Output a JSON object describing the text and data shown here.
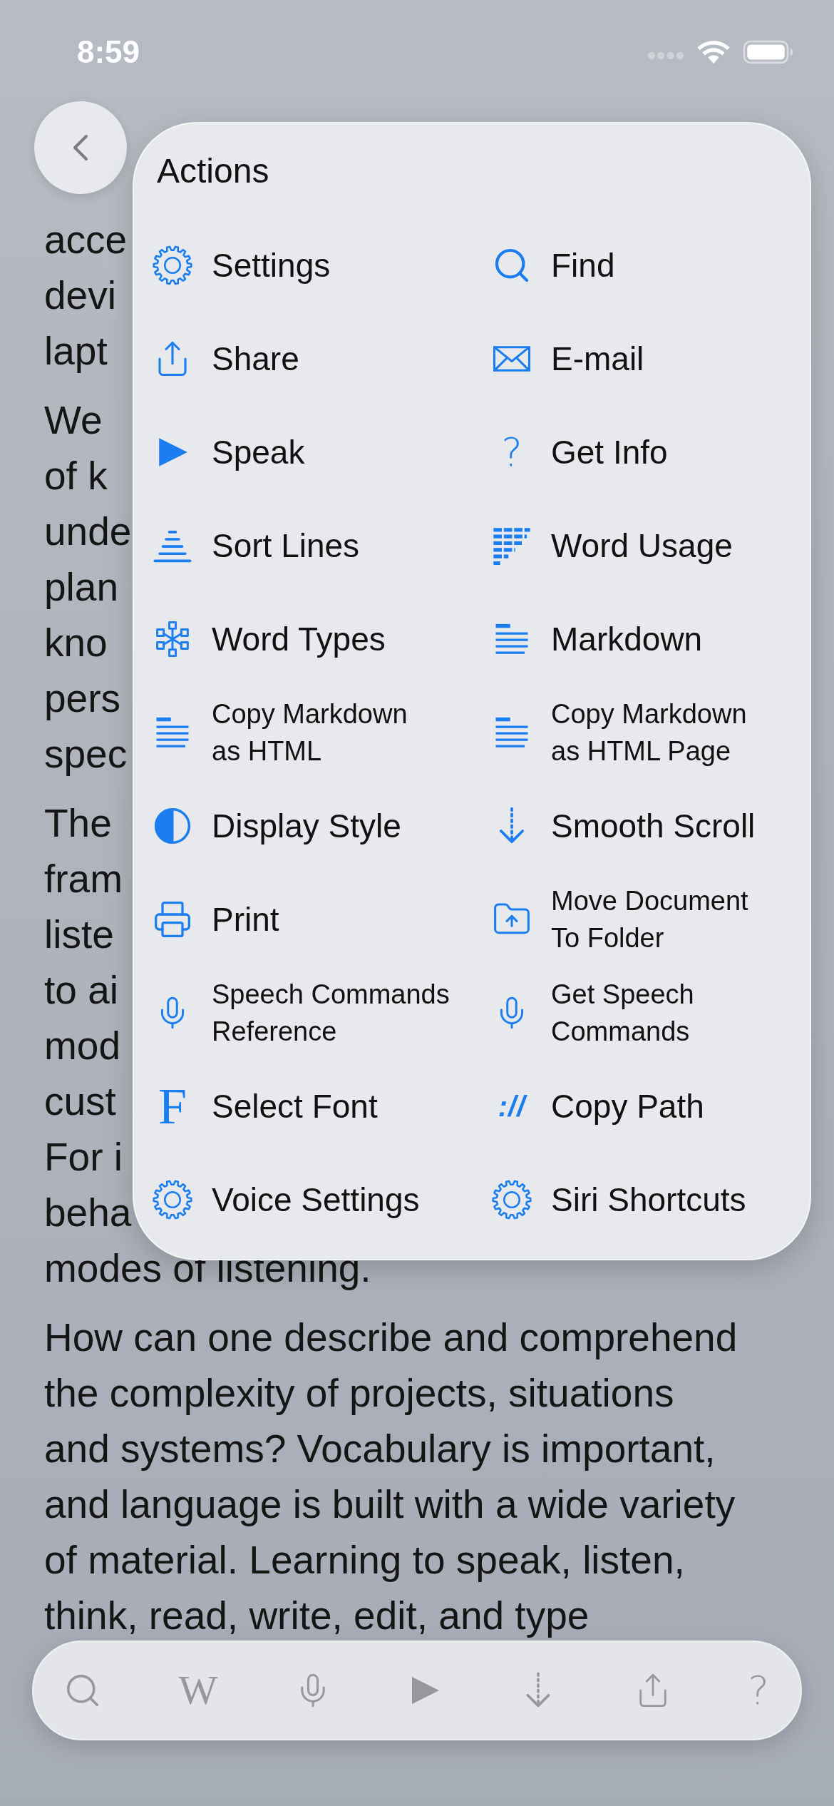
{
  "status_bar": {
    "time": "8:59"
  },
  "document": {
    "paragraphs": [
      [
        "acce",
        "devi",
        "lapt"
      ],
      [
        "We",
        "of k",
        "unde",
        "plan",
        "kno",
        "pers",
        "spec"
      ],
      [
        "The",
        "fram",
        "liste",
        "to ai",
        "mod",
        "cust",
        "For i",
        "beha",
        "modes of listening."
      ],
      [
        "How can one describe and comprehend",
        "the complexity of projects, situations",
        "and systems? Vocabulary is important,",
        "and language is built with a wide variety",
        "of material. Learning to speak, listen,",
        "think, read, write, edit, and type"
      ]
    ]
  },
  "actions_menu": {
    "title": "Actions",
    "items": [
      {
        "kind": "icon",
        "label": "Settings"
      },
      {
        "kind": "icon",
        "label": "Find"
      },
      {
        "kind": "icon",
        "label": "Share"
      },
      {
        "kind": "icon",
        "label": "E-mail"
      },
      {
        "kind": "icon",
        "label": "Speak"
      },
      {
        "kind": "question",
        "glyph": "?",
        "label": "Get Info"
      },
      {
        "kind": "icon",
        "label": "Sort Lines"
      },
      {
        "kind": "icon",
        "label": "Word Usage"
      },
      {
        "kind": "icon",
        "label": "Word Types"
      },
      {
        "kind": "icon",
        "label": "Markdown"
      },
      {
        "kind": "icon",
        "lines": [
          "Copy Markdown",
          "as HTML"
        ]
      },
      {
        "kind": "icon",
        "lines": [
          "Copy Markdown",
          "as HTML Page"
        ]
      },
      {
        "kind": "icon",
        "label": "Display Style"
      },
      {
        "kind": "icon",
        "label": "Smooth Scroll"
      },
      {
        "kind": "icon",
        "label": "Print"
      },
      {
        "kind": "icon",
        "lines": [
          "Move Document",
          "To Folder"
        ]
      },
      {
        "kind": "icon",
        "lines": [
          "Speech Commands",
          "Reference"
        ]
      },
      {
        "kind": "icon",
        "lines": [
          "Get Speech",
          "Commands"
        ]
      },
      {
        "kind": "letter",
        "glyph": "F",
        "label": "Select Font"
      },
      {
        "kind": "slashes",
        "glyph": "://",
        "label": "Copy Path"
      },
      {
        "kind": "icon",
        "label": "Voice Settings"
      },
      {
        "kind": "icon",
        "label": "Siri Shortcuts"
      }
    ]
  },
  "toolbar": {
    "buttons": [
      {
        "kind": "icon"
      },
      {
        "kind": "letter",
        "glyph": "W"
      },
      {
        "kind": "icon"
      },
      {
        "kind": "icon"
      },
      {
        "kind": "icon"
      },
      {
        "kind": "icon"
      },
      {
        "kind": "question",
        "glyph": "?"
      }
    ]
  }
}
